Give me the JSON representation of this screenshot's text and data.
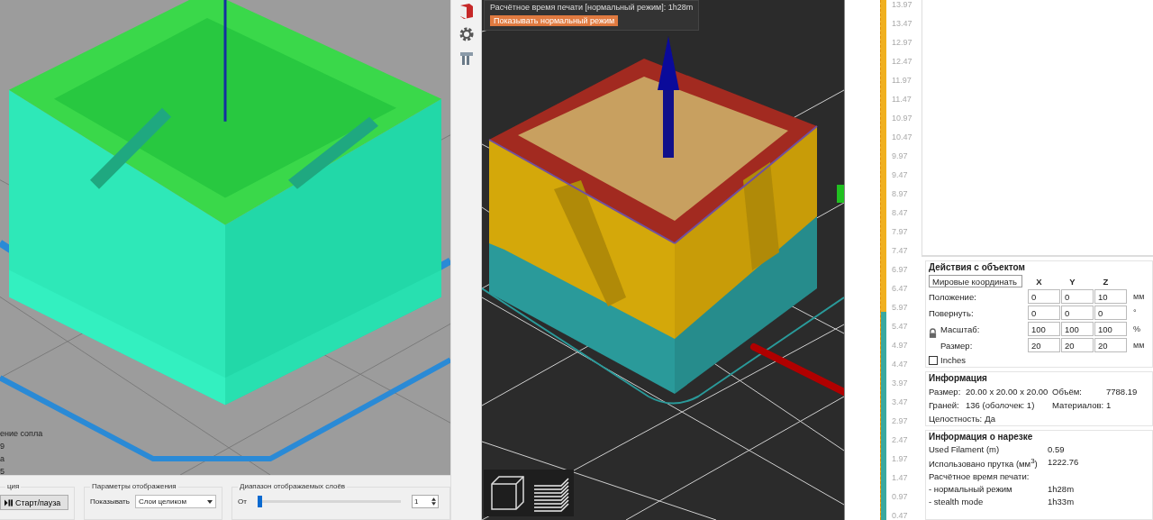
{
  "left_view": {
    "legend_lines": [
      "ение сопла",
      "9",
      "а",
      "5"
    ],
    "bottom_panel": {
      "playback": {
        "title": "ция",
        "button": "Старт/пауза"
      },
      "display": {
        "title": "Параметры отображения",
        "show_label": "Показывать",
        "show_value": "Слои целиком"
      },
      "range": {
        "title": "Диапазон отображаемых слоёв",
        "from_label": "От",
        "from_value": "1",
        "level": 0.0
      }
    }
  },
  "preview": {
    "estimate_text": "Расчётное время печати [нормальный режим]: 1h28m",
    "mode_button": "Показывать нормальный режим"
  },
  "layer_slider": {
    "level": 0.4,
    "labels": [
      "13.97",
      "13.47",
      "12.97",
      "12.47",
      "11.97",
      "11.47",
      "10.97",
      "10.47",
      "9.97",
      "9.47",
      "8.97",
      "8.47",
      "7.97",
      "7.47",
      "6.97",
      "6.47",
      "5.97",
      "5.47",
      "4.97",
      "4.47",
      "3.97",
      "3.47",
      "2.97",
      "2.47",
      "1.97",
      "1.47",
      "0.97",
      "0.47"
    ]
  },
  "object_actions": {
    "title": "Действия с объектом",
    "coord_select": "Мировые координать",
    "axes": [
      "X",
      "Y",
      "Z"
    ],
    "rows": [
      {
        "label": "Положение:",
        "values": [
          "0",
          "0",
          "10"
        ],
        "unit": "мм"
      },
      {
        "label": "Повернуть:",
        "values": [
          "0",
          "0",
          "0"
        ],
        "unit": "°"
      },
      {
        "label": "Масштаб:",
        "values": [
          "100",
          "100",
          "100"
        ],
        "unit": "%"
      },
      {
        "label": "Размер:",
        "values": [
          "20",
          "20",
          "20"
        ],
        "unit": "мм"
      }
    ],
    "inches": {
      "label": "Inches",
      "checked": false
    }
  },
  "info": {
    "title": "Информация",
    "rows": [
      [
        {
          "label": "Размер:",
          "value": "20.00 x 20.00 x 20.00"
        },
        {
          "label": "Объём:",
          "value": "7788.19"
        }
      ],
      [
        {
          "label": "Граней:",
          "value": "136 (оболочек: 1)"
        },
        {
          "label": "Материалов:",
          "value": "1"
        }
      ],
      [
        {
          "label": "Целостность:",
          "value": "Да"
        }
      ]
    ]
  },
  "slice_info": {
    "title": "Информация о нарезке",
    "rows": [
      {
        "label": "Used Filament (m)",
        "value": "0.59"
      },
      {
        "label": "Использовано прутка (мм$^{3}$)",
        "value": "1222.76"
      },
      {
        "label": "Расчётное время печати:"
      },
      {
        "label": "- нормальный режим",
        "value": "1h28m"
      },
      {
        "label": "- stealth mode",
        "value": "1h33m"
      }
    ]
  }
}
